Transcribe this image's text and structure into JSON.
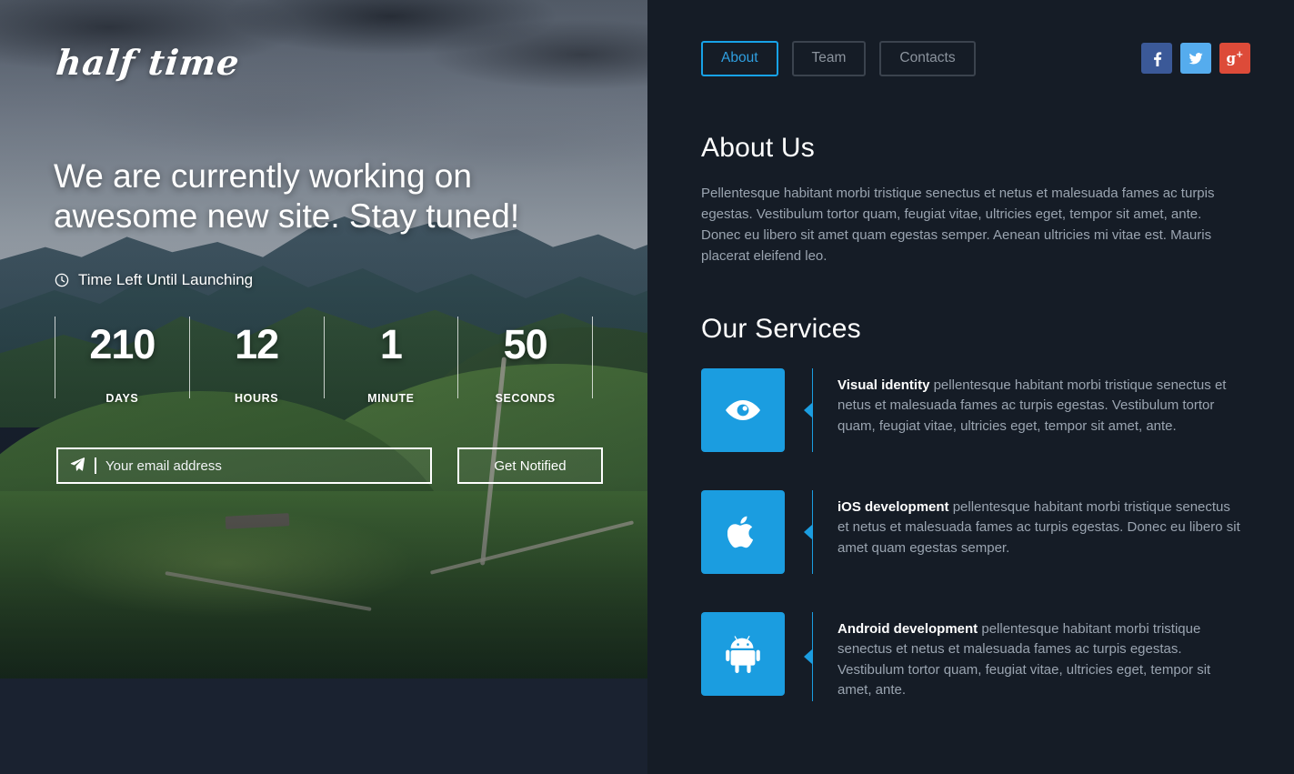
{
  "brand": {
    "logo": "half time"
  },
  "hero": {
    "headline": "We are currently working on awesome new site. Stay tuned!",
    "countdown_label": "Time Left Until Launching",
    "countdown": [
      {
        "value": "210",
        "label": "DAYS"
      },
      {
        "value": "12",
        "label": "HOURS"
      },
      {
        "value": "1",
        "label": "MINUTE"
      },
      {
        "value": "50",
        "label": "SECONDS"
      }
    ],
    "subscribe": {
      "email_value": "",
      "email_placeholder": "Your email address",
      "button_label": "Get Notified",
      "send_icon": "paper-plane-icon",
      "clock_icon": "clock-icon"
    }
  },
  "nav": {
    "items": [
      {
        "label": "About",
        "active": true
      },
      {
        "label": "Team",
        "active": false
      },
      {
        "label": "Contacts",
        "active": false
      }
    ]
  },
  "socials": [
    {
      "name": "facebook-icon",
      "label": "f",
      "color": "#3b5998"
    },
    {
      "name": "twitter-icon",
      "label": "t",
      "color": "#55acee"
    },
    {
      "name": "google-plus-icon",
      "label": "g+",
      "color": "#dd4b39"
    }
  ],
  "about": {
    "title": "About Us",
    "body": "Pellentesque habitant morbi tristique senectus et netus et malesuada fames ac turpis egestas. Vestibulum tortor quam, feugiat vitae, ultricies eget, tempor sit amet, ante. Donec eu libero sit amet quam egestas semper. Aenean ultricies mi vitae est. Mauris placerat eleifend leo."
  },
  "services": {
    "title": "Our Services",
    "items": [
      {
        "icon": "eye-icon",
        "heading": "Visual identity",
        "body": " pellentesque habitant morbi tristique senectus et netus et malesuada fames ac turpis egestas. Vestibulum tortor quam, feugiat vitae, ultricies eget, tempor sit amet, ante."
      },
      {
        "icon": "apple-icon",
        "heading": "iOS development",
        "body": " pellentesque habitant morbi tristique senectus et netus et malesuada fames ac turpis egestas. Donec eu libero sit amet quam egestas semper."
      },
      {
        "icon": "android-icon",
        "heading": "Android development",
        "body": " pellentesque habitant morbi tristique senectus et netus et malesuada fames ac turpis egestas. Vestibulum tortor quam, feugiat vitae, ultricies eget, tempor sit amet, ante."
      }
    ]
  },
  "colors": {
    "accent": "#1b9de0",
    "panel_bg": "#151c26",
    "hero_bg": "#1a2230",
    "body_text": "#9aa4b0",
    "nav_active": "#2f9fe0",
    "nav_idle": "#8b939d"
  }
}
